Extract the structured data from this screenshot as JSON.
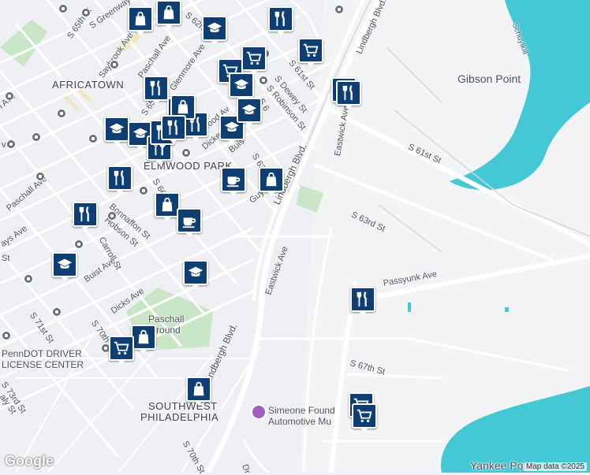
{
  "colors": {
    "background": "#eef0f3",
    "water": "#45c8d6",
    "park": "#c9e6c6",
    "road": "#ffffff",
    "marker": "#0f3f72"
  },
  "map": {
    "neighborhoods": {
      "africatown": "AFRICATOWN",
      "elmwood_park": "ELMWOOD PARK",
      "southwest_philadelphia_1": "SOUTHWEST",
      "southwest_philadelphia_2": "PHILADELPHIA"
    },
    "places": {
      "gibson_point": "Gibson Point",
      "yankee_point": "Yankee Point",
      "schuylkill": "Schuylkill",
      "penndot_1": "PennDOT DRIVER",
      "penndot_2": "LICENSE CENTER",
      "paschall_1": "Paschall",
      "paschall_2": "Playground",
      "simeone_1": "Simeone Found",
      "simeone_2": "Automotive Mu"
    },
    "streets": {
      "s65th_a": "S 65th St",
      "greenway": "S Greenway",
      "saybrook": "Saybrook Ave",
      "paschall_ave_top": "Paschall Ave",
      "glenmore": "Glenmore Ave",
      "s62nd": "S 62n",
      "s65th_b": "S 65th",
      "s61st": "S 61st St",
      "s_dewey": "S Dewey St",
      "s_robinson": "S Robinson St",
      "lindbergh_top": "Lindbergh Blvd.",
      "lindbergh_mid": "Lindbergh Blvd.",
      "lindbergh_low": "Lindbergh Blvd.",
      "eastwick_top": "Eastwick Ave",
      "eastwick_mid": "Eastwick Ave",
      "s61st_east": "S 61st St",
      "s63rd": "S 63rd St",
      "s63rd_west": "S 63rd St",
      "passyunk": "Passyunk Ave",
      "s67th": "S 67th St",
      "paschall_ave_left": "Paschall Ave",
      "s66th": "S 66th St",
      "bonnaffon": "Bonnaffon St",
      "hobson": "Hobson St",
      "carroll": "Carroll St",
      "buist": "Buist Ave",
      "dicks_low": "Dicks Ave",
      "s70th_a": "S 70th St",
      "s71st": "S 71st St",
      "s73rd": "S 73rd St",
      "s70th_b": "S 70th St",
      "guyer": "Guye",
      "dicks_top": "Dicke",
      "buist_top": "Buis",
      "wood_ave": "wood Av",
      "lays_ave": "ays Ave",
      "aly": "aly St",
      "dr": "Dr",
      "lave": "l Ave",
      "s6": "S 6",
      "ave_small": "ve",
      "st_small": "St"
    },
    "attribution": "Map data ©2025",
    "logo": "Google"
  },
  "markers": [
    {
      "icon": "shopping-bag-icon"
    },
    {
      "icon": "shopping-bag-icon"
    },
    {
      "icon": "graduation-cap-icon"
    },
    {
      "icon": "restaurant-icon"
    },
    {
      "icon": "shopping-cart-icon"
    },
    {
      "icon": "shopping-cart-icon"
    },
    {
      "icon": "shopping-cart-icon"
    },
    {
      "icon": "graduation-cap-icon"
    },
    {
      "icon": "restaurant-icon"
    },
    {
      "icon": "restaurant-icon"
    },
    {
      "icon": "restaurant-icon"
    },
    {
      "icon": "shopping-bag-icon"
    },
    {
      "icon": "graduation-cap-icon"
    },
    {
      "icon": "graduation-cap-icon"
    },
    {
      "icon": "restaurant-icon"
    },
    {
      "icon": "restaurant-icon"
    },
    {
      "icon": "restaurant-icon"
    },
    {
      "icon": "graduation-cap-icon"
    },
    {
      "icon": "graduation-cap-icon"
    },
    {
      "icon": "restaurant-icon"
    },
    {
      "icon": "restaurant-icon"
    },
    {
      "icon": "restaurant-icon"
    },
    {
      "icon": "coffee-icon"
    },
    {
      "icon": "shopping-bag-icon"
    },
    {
      "icon": "shopping-bag-icon"
    },
    {
      "icon": "coffee-icon"
    },
    {
      "icon": "restaurant-icon"
    },
    {
      "icon": "graduation-cap-icon"
    },
    {
      "icon": "graduation-cap-icon"
    },
    {
      "icon": "restaurant-icon"
    },
    {
      "icon": "shopping-bag-icon"
    },
    {
      "icon": "shopping-cart-icon"
    },
    {
      "icon": "shopping-bag-icon"
    },
    {
      "icon": "shopping-cart-icon"
    },
    {
      "icon": "shopping-cart-icon"
    }
  ]
}
